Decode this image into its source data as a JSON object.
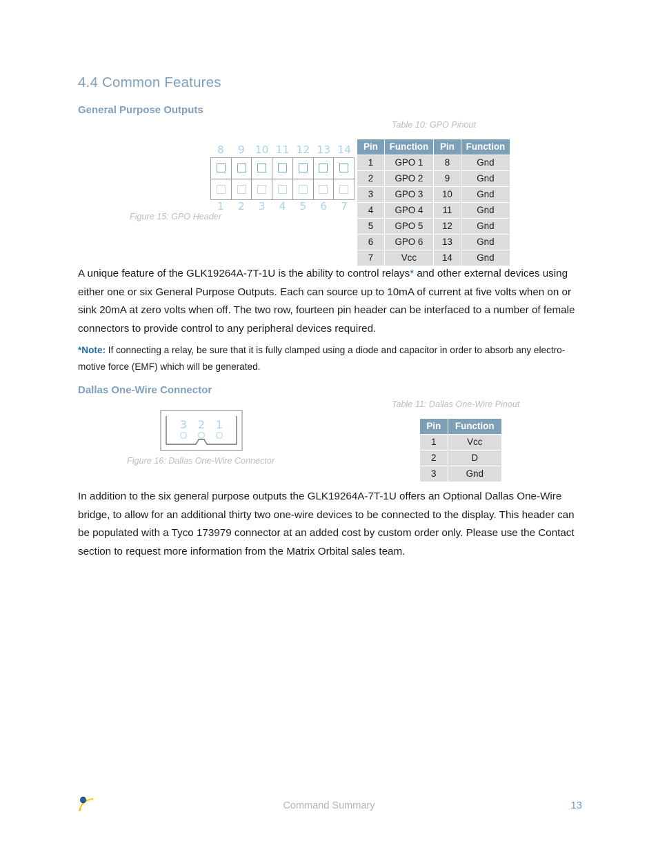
{
  "section": {
    "number_title": "4.4 Common Features",
    "sub_gpo": "General Purpose Outputs",
    "sub_dallas": "Dallas One-Wire Connector"
  },
  "captions": {
    "table_10": "Table 10: GPO Pinout",
    "figure_15": "Figure 15: GPO Header",
    "table_11": "Table 11: Dallas One-Wire Pinout",
    "figure_16": "Figure 16: Dallas One-Wire Connector"
  },
  "gpo_table": {
    "headers": [
      "Pin",
      "Function",
      "Pin",
      "Function"
    ],
    "rows": [
      [
        "1",
        "GPO 1",
        "8",
        "Gnd"
      ],
      [
        "2",
        "GPO 2",
        "9",
        "Gnd"
      ],
      [
        "3",
        "GPO 3",
        "10",
        "Gnd"
      ],
      [
        "4",
        "GPO 4",
        "11",
        "Gnd"
      ],
      [
        "5",
        "GPO 5",
        "12",
        "Gnd"
      ],
      [
        "6",
        "GPO 6",
        "13",
        "Gnd"
      ],
      [
        "7",
        "Vcc",
        "14",
        "Gnd"
      ]
    ]
  },
  "dallas_table": {
    "headers": [
      "Pin",
      "Function"
    ],
    "rows": [
      [
        "1",
        "Vcc"
      ],
      [
        "2",
        "D"
      ],
      [
        "3",
        "Gnd"
      ]
    ]
  },
  "gpo_header_figure": {
    "top_pin_labels": [
      "8",
      "9",
      "10",
      "11",
      "12",
      "13",
      "14"
    ],
    "bottom_pin_labels": [
      "1",
      "2",
      "3",
      "4",
      "5",
      "6",
      "7"
    ]
  },
  "dallas_figure": {
    "pin_labels": [
      "3",
      "2",
      "1"
    ]
  },
  "body": {
    "paragraph_1_part1": "A unique feature of the GLK19264A-7T-1U is the ability to control relays",
    "paragraph_1_star": "*",
    "paragraph_1_part2": " and other external devices using either one or six General Purpose Outputs.  Each can source up to 10mA of current at five volts when on or sink 20mA at zero volts when off.  The two row, fourteen pin header can be interfaced to a number of female connectors to provide control to any peripheral devices required.",
    "note_label": "*Note:",
    "note_text": " If connecting a relay, be sure that it is fully clamped using a diode and capacitor in order to absorb any electro-motive force (EMF) which will be generated.",
    "paragraph_2": "In addition to the six general purpose outputs the GLK19264A-7T-1U offers an Optional Dallas One-Wire bridge, to allow for an additional thirty two one-wire devices to be connected to the display.  This header can be populated with a Tyco 173979 connector at an added cost by custom order only.  Please use the Contact section to request more information from the Matrix Orbital sales team."
  },
  "footer": {
    "center_text": "Command Summary",
    "page_number": "13"
  },
  "colors": {
    "heading_blue": "#7f9fbc",
    "table_header_blue": "#7d9fb8",
    "table_cell_gray": "#dcdcdc",
    "caption_gray": "#bdbdbd",
    "accent_link_blue": "#1f6f9c",
    "figure_pin_blue": "#a8d4e6"
  }
}
